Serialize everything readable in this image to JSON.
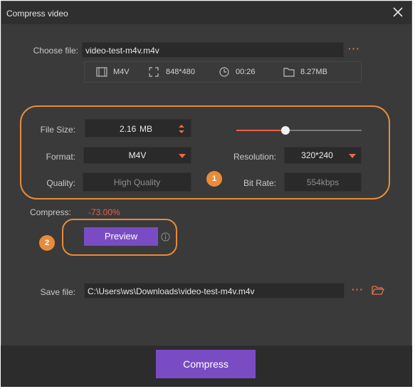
{
  "window": {
    "title": "Compress video"
  },
  "choose_file": {
    "label": "Choose file:",
    "value": "video-test-m4v.m4v"
  },
  "file_info": {
    "format": "M4V",
    "resolution": "848*480",
    "duration": "00:26",
    "size": "8.27MB"
  },
  "settings": {
    "file_size_label": "File Size:",
    "file_size_value": "2.16",
    "file_size_unit": "MB",
    "slider_fraction": 0.39,
    "format_label": "Format:",
    "format_value": "M4V",
    "resolution_label": "Resolution:",
    "resolution_value": "320*240",
    "quality_label": "Quality:",
    "quality_value": "High Quality",
    "bitrate_label": "Bit Rate:",
    "bitrate_value": "554kbps",
    "badge": "1"
  },
  "compress_ratio": {
    "label": "Compress:",
    "value": "-73.00%"
  },
  "preview": {
    "label": "Preview",
    "badge": "2"
  },
  "save_file": {
    "label": "Save file:",
    "value": "C:\\Users\\ws\\Downloads\\video-test-m4v.m4v"
  },
  "footer": {
    "compress_label": "Compress"
  },
  "colors": {
    "accent": "#7a4cc4",
    "highlight": "#e88b3a",
    "negative": "#e8604a"
  }
}
